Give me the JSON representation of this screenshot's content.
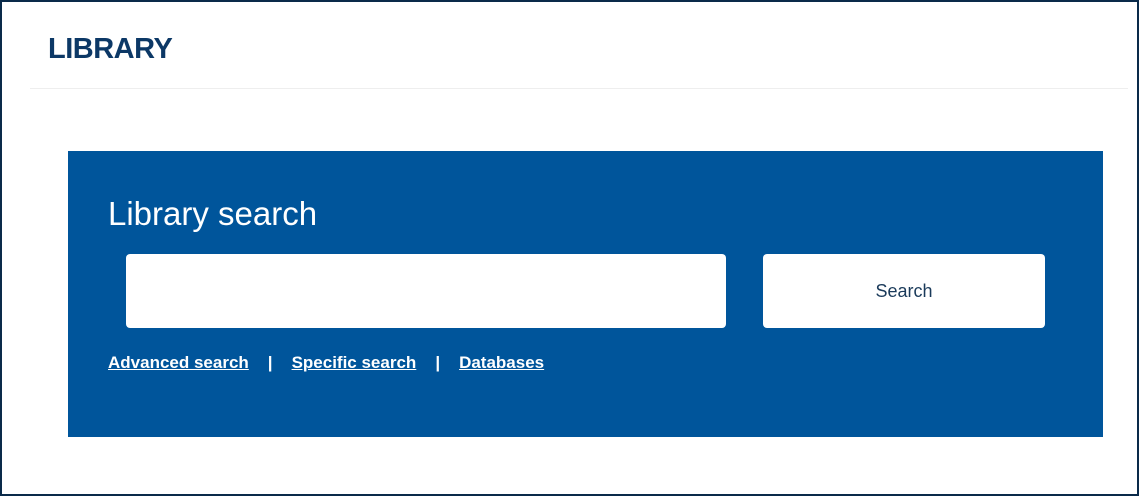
{
  "header": {
    "brand": "LIBRARY"
  },
  "search": {
    "title": "Library search",
    "input_value": "",
    "placeholder": "",
    "button_label": "Search",
    "links": [
      {
        "label": "Advanced search"
      },
      {
        "label": "Specific search"
      },
      {
        "label": "Databases"
      }
    ],
    "separator": "|"
  },
  "colors": {
    "brand": "#0c3866",
    "panel_background": "#00559b",
    "frame_border": "#0a2a4a",
    "page_background": "#ffffff"
  }
}
